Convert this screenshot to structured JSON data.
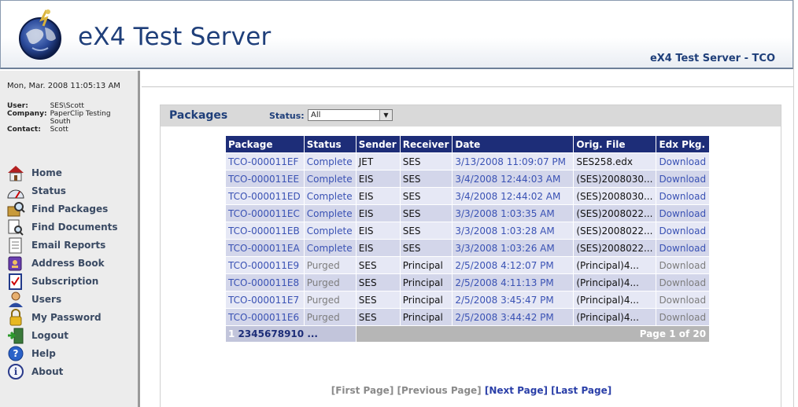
{
  "header": {
    "app_title": "eX4 Test Server",
    "server_label": "eX4 Test Server - TCO"
  },
  "sidebar": {
    "datetime": "Mon, Mar. 2008 11:05:13 AM",
    "user_key": "User:",
    "user_value": "SES\\Scott",
    "company_key": "Company:",
    "company_value": "PaperClip Testing South",
    "contact_key": "Contact:",
    "contact_value": "Scott",
    "items": [
      {
        "label": "Home",
        "icon": "home-icon"
      },
      {
        "label": "Status",
        "icon": "status-gauge-icon"
      },
      {
        "label": "Find Packages",
        "icon": "find-packages-icon"
      },
      {
        "label": "Find Documents",
        "icon": "find-documents-icon"
      },
      {
        "label": "Email Reports",
        "icon": "email-reports-icon"
      },
      {
        "label": "Address Book",
        "icon": "address-book-icon"
      },
      {
        "label": "Subscription",
        "icon": "subscription-icon"
      },
      {
        "label": "Users",
        "icon": "users-icon"
      },
      {
        "label": "My Password",
        "icon": "lock-icon"
      },
      {
        "label": "Logout",
        "icon": "logout-icon"
      },
      {
        "label": "Help",
        "icon": "help-icon"
      },
      {
        "label": "About",
        "icon": "about-icon"
      }
    ]
  },
  "panel": {
    "title": "Packages",
    "status_label": "Status:",
    "status_value": "All"
  },
  "table": {
    "columns": [
      "Package",
      "Status",
      "Sender",
      "Receiver",
      "Date",
      "Orig. File",
      "Edx Pkg."
    ],
    "rows": [
      [
        "TCO-000011EF",
        "Complete",
        "JET",
        "SES",
        "3/13/2008 11:09:07 PM",
        "SES258.edx",
        "Download"
      ],
      [
        "TCO-000011EE",
        "Complete",
        "EIS",
        "SES",
        "3/4/2008 12:44:03 AM",
        "(SES)2008030...",
        "Download"
      ],
      [
        "TCO-000011ED",
        "Complete",
        "EIS",
        "SES",
        "3/4/2008 12:44:02 AM",
        "(SES)2008030...",
        "Download"
      ],
      [
        "TCO-000011EC",
        "Complete",
        "EIS",
        "SES",
        "3/3/2008 1:03:35 AM",
        "(SES)2008022...",
        "Download"
      ],
      [
        "TCO-000011EB",
        "Complete",
        "EIS",
        "SES",
        "3/3/2008 1:03:28 AM",
        "(SES)2008022...",
        "Download"
      ],
      [
        "TCO-000011EA",
        "Complete",
        "EIS",
        "SES",
        "3/3/2008 1:03:26 AM",
        "(SES)2008022...",
        "Download"
      ],
      [
        "TCO-000011E9",
        "Purged",
        "SES",
        "Principal",
        "2/5/2008 4:12:07 PM",
        "(Principal)4...",
        "Download"
      ],
      [
        "TCO-000011E8",
        "Purged",
        "SES",
        "Principal",
        "2/5/2008 4:11:13 PM",
        "(Principal)4...",
        "Download"
      ],
      [
        "TCO-000011E7",
        "Purged",
        "SES",
        "Principal",
        "2/5/2008 3:45:47 PM",
        "(Principal)4...",
        "Download"
      ],
      [
        "TCO-000011E6",
        "Purged",
        "SES",
        "Principal",
        "2/5/2008 3:44:42 PM",
        "(Principal)4...",
        "Download"
      ]
    ],
    "pager_pages": [
      "1",
      "2",
      "3",
      "4",
      "5",
      "6",
      "7",
      "8",
      "9",
      "10",
      "..."
    ],
    "pager_current": "1",
    "page_info": "Page 1 of 20"
  },
  "footer_nav": {
    "first": "[First Page]",
    "previous": "[Previous Page]",
    "next": "[Next Page]",
    "last": "[Last Page]"
  },
  "colors": {
    "header_blue": "#1f3f7a",
    "table_header": "#1d2d78",
    "row_light": "#e6e8f5",
    "row_dark": "#d3d6ea",
    "link": "#3a52b4",
    "purged_text": "#7d7d7d"
  }
}
